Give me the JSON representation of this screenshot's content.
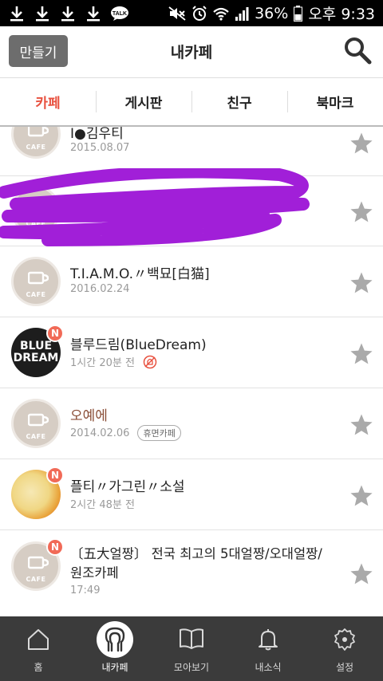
{
  "status_bar": {
    "time": "오후 9:33",
    "battery": "36%",
    "icons": [
      "download-icon",
      "download-icon",
      "download-icon",
      "download-icon",
      "kakaotalk-icon",
      "mute-icon",
      "alarm-icon",
      "wifi-icon",
      "signal-icon",
      "battery-icon"
    ],
    "talk_label": "TALK"
  },
  "header": {
    "make_button": "만들기",
    "title": "내카페",
    "search_icon": "search-icon"
  },
  "tabs": [
    {
      "label": "카페",
      "active": true
    },
    {
      "label": "게시판",
      "active": false
    },
    {
      "label": "친구",
      "active": false
    },
    {
      "label": "북마크",
      "active": false
    }
  ],
  "cafe_list": [
    {
      "name": "I●김우티",
      "date": "2015.08.07",
      "logo": "cafe-default",
      "new": false
    },
    {
      "name": "",
      "date": "",
      "logo": "cafe-default",
      "new": false,
      "scribbled": true
    },
    {
      "name": "T.I.A.M.O.〃백묘[白猫]",
      "date": "2016.02.24",
      "logo": "cafe-default",
      "new": false
    },
    {
      "name": "블루드림(BlueDream)",
      "date": "1시간 20분 전",
      "logo": "bluedream",
      "new": true,
      "logo_text": [
        "BLUE",
        "DREAM"
      ],
      "badge": "N"
    },
    {
      "name": "오예에",
      "date": "2014.02.06",
      "logo": "cafe-default",
      "new": false,
      "chip": "휴면카페",
      "name_color": "#8a4d36"
    },
    {
      "name": "플티〃가그린〃소설",
      "date": "2시간 48분 전",
      "logo": "painting",
      "new": true,
      "badge": "N"
    },
    {
      "name": "〔五大얼짱〕 전국 최고의 5대얼짱/오대얼짱/",
      "name_line2": "원조카페",
      "date": "17:49",
      "logo": "cafe-default",
      "new": true,
      "badge": "N"
    }
  ],
  "cafe_logo_text": "CAFE",
  "bottom_nav": [
    {
      "label": "홈",
      "icon": "home-icon",
      "active": false
    },
    {
      "label": "내카페",
      "icon": "mycafe-icon",
      "active": true
    },
    {
      "label": "모아보기",
      "icon": "book-icon",
      "active": false
    },
    {
      "label": "내소식",
      "icon": "bell-icon",
      "active": false
    },
    {
      "label": "설정",
      "icon": "gear-icon",
      "active": false
    }
  ],
  "colors": {
    "accent": "#e8513f",
    "badge": "#f16a57",
    "nav_bg": "#3b3b3b",
    "scribble": "#a11fd8"
  }
}
